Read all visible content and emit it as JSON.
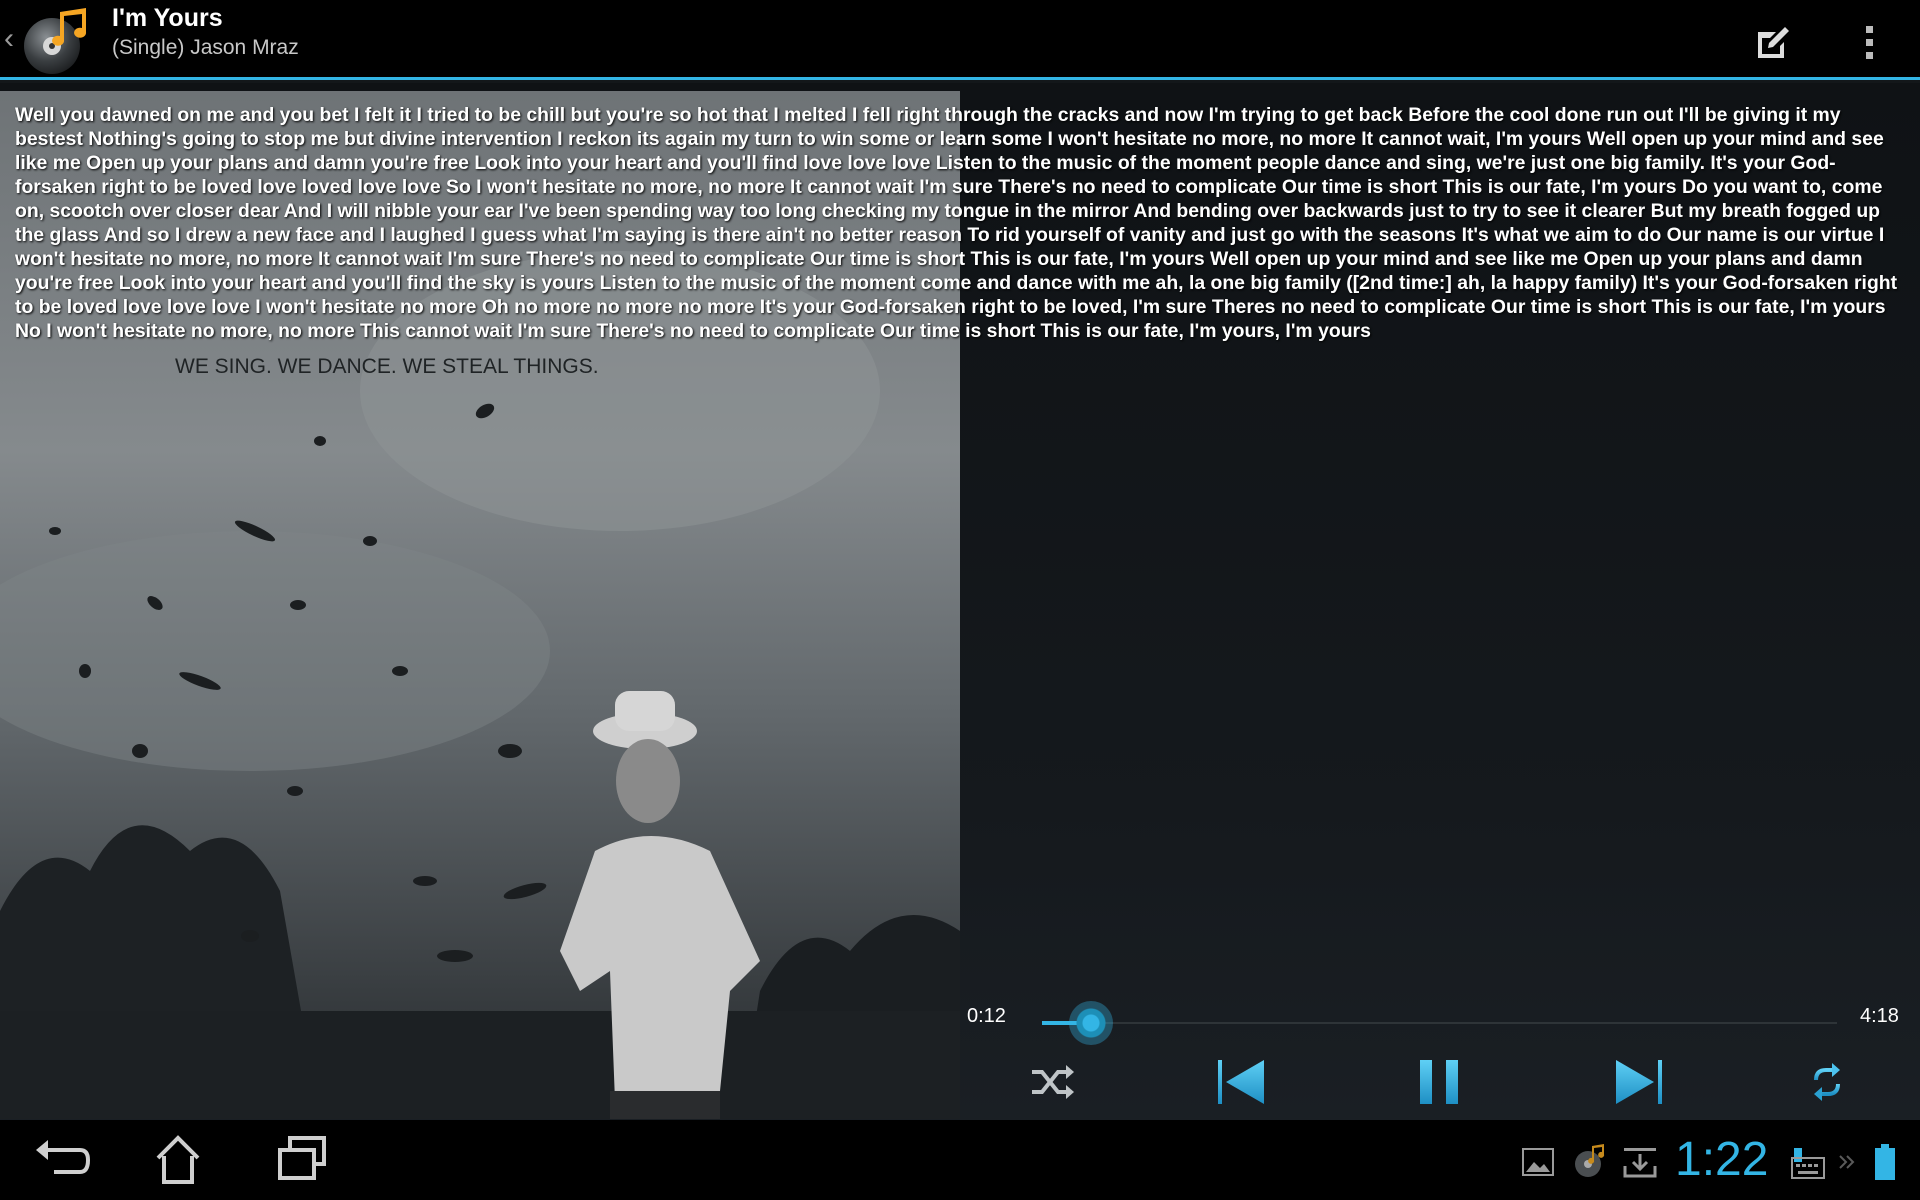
{
  "header": {
    "title": "I'm Yours",
    "subtitle": "(Single) Jason Mraz",
    "edit_icon": "edit-lyrics-icon",
    "overflow_icon": "overflow-menu-icon"
  },
  "album_art": {
    "lettering": "WE SING. WE DANCE. WE STEAL THINGS."
  },
  "lyrics": "Well you dawned on me and you bet I felt it I tried to be chill but you're so hot that I melted I fell right through the cracks and now I'm trying to get back Before the cool done run out I'll be giving it my bestest Nothing's going to stop me but divine intervention I reckon its again my turn to win some or learn some I won't hesitate no more, no more It cannot wait, I'm yours Well open up your mind and see like me Open up your plans and damn you're free Look into your heart and you'll find love love love Listen to the music of the moment people dance and sing, we're just one big family. It's your God-forsaken right to be loved love loved love love So I won't hesitate no more, no more It cannot wait I'm sure There's no need to complicate Our time is short This is our fate, I'm yours Do you want to, come on, scootch over closer dear And I will nibble your ear I've been spending way too long checking my tongue in the mirror And bending over backwards just to try to see it clearer But my breath fogged up the glass And so I drew a new face and I laughed I guess what I'm saying is there ain't no better reason To rid yourself of vanity and just go with the seasons It's what we aim to do Our name is our virtue I won't hesitate no more, no more It cannot wait I'm sure There's no need to complicate Our time is short This is our fate, I'm yours Well open up your mind and see like me Open up your plans and damn you're free Look into your heart and you'll find the sky is yours Listen to the music of the moment come and dance with me ah, la one big family ([2nd time:] ah, la happy family) It's your God-forsaken right to be loved love love love I won't hesitate no more Oh no more no more no more It's your God-forsaken right to be loved, I'm sure Theres no need to complicate Our time is short This is our fate, I'm yours No I won't hesitate no more, no more This cannot wait I'm sure There's no need to complicate Our time is short This is our fate, I'm yours, I'm yours",
  "player": {
    "current_time": "0:12",
    "total_time": "4:18",
    "progress": 0.047,
    "shuffle_icon": "shuffle-icon",
    "prev_icon": "previous-track-icon",
    "pause_icon": "pause-icon",
    "next_icon": "next-track-icon",
    "repeat_icon": "repeat-icon",
    "accent": "#33b5e5"
  },
  "system_bar": {
    "clock": "1:22",
    "back_icon": "back-icon",
    "home_icon": "home-icon",
    "recents_icon": "recent-apps-icon",
    "notifications": [
      "gallery-icon",
      "music-notification-icon",
      "download-icon"
    ],
    "status_icons": [
      "keyboard-icon",
      "expand-icon",
      "battery-icon"
    ]
  }
}
